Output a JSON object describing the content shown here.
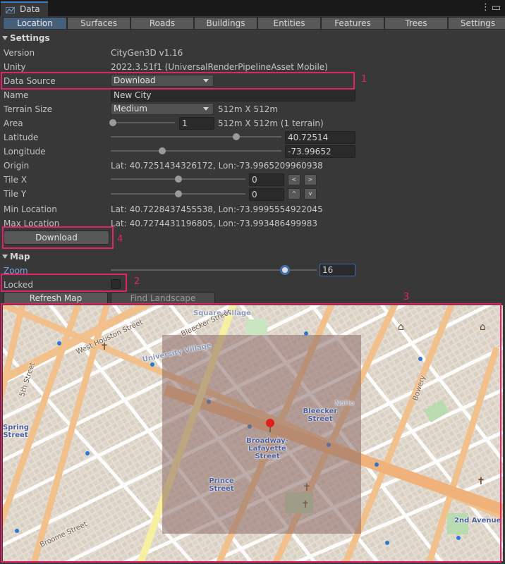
{
  "window": {
    "tab_title": "Data"
  },
  "tabs": [
    "Location",
    "Surfaces",
    "Roads",
    "Buildings",
    "Entities",
    "Features",
    "Trees",
    "Settings"
  ],
  "settings": {
    "header": "Settings",
    "version": {
      "label": "Version",
      "value": "CityGen3D v1.16"
    },
    "unity": {
      "label": "Unity",
      "value": "2022.3.51f1  (UniversalRenderPipelineAsset Mobile)"
    },
    "data_source": {
      "label": "Data Source",
      "value": "Download"
    },
    "name": {
      "label": "Name",
      "value": "New City"
    },
    "terrain_size": {
      "label": "Terrain Size",
      "value": "Medium",
      "info": "512m X 512m"
    },
    "area": {
      "label": "Area",
      "value": "1",
      "info": "512m X 512m (1 terrain)",
      "slider": 0.0
    },
    "latitude": {
      "label": "Latitude",
      "value": "40.72514",
      "slider": 0.735
    },
    "longitude": {
      "label": "Longitude",
      "value": "-73.99652",
      "slider": 0.3
    },
    "origin": {
      "label": "Origin",
      "value": "Lat: 40.7251434326172, Lon:-73.9965209960938"
    },
    "tile_x": {
      "label": "Tile X",
      "value": "0",
      "slider": 0.5,
      "btn_prev": "<",
      "btn_next": ">"
    },
    "tile_y": {
      "label": "Tile Y",
      "value": "0",
      "slider": 0.5,
      "btn_prev": "^",
      "btn_next": "v"
    },
    "min_location": {
      "label": "Min Location",
      "value": "Lat: 40.7228437455538, Lon:-73.9995554922045"
    },
    "max_location": {
      "label": "Max Location",
      "value": "Lat: 40.7274431196805, Lon:-73.993486499983"
    },
    "download_button": "Download"
  },
  "map_section": {
    "header": "Map",
    "zoom": {
      "label": "Zoom",
      "value": "16",
      "slider": 1.0
    },
    "locked": {
      "label": "Locked",
      "checked": false
    },
    "refresh_button": "Refresh Map",
    "find_button": "Find Landscape"
  },
  "map_labels": {
    "square_village": "Square Village",
    "university_village": "University Village",
    "bleecker": "Bleecker\nStreet",
    "broadway": "Broadway-\nLafayette\nStreet",
    "prince": "Prince\nStreet",
    "spring": "Spring\nStreet",
    "second_ave": "2nd Avenue",
    "noho": "NoHo",
    "w_houston": "West Houston Street",
    "bleecker_st": "Bleecker Street",
    "broome": "Broome Street",
    "bowery": "Bowery",
    "fifth": "5th Street"
  },
  "annotations": [
    "1",
    "2",
    "3",
    "4"
  ],
  "colors": {
    "accent": "#e0246c",
    "tab_active": "#46607c"
  }
}
